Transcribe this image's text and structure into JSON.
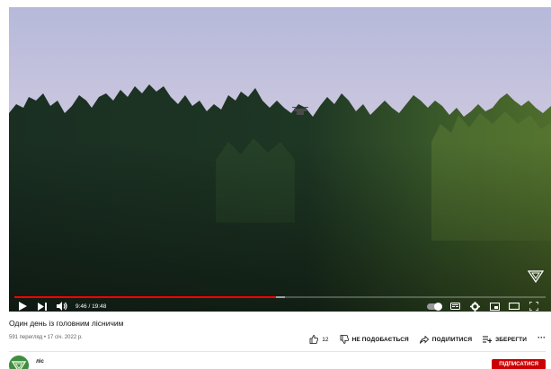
{
  "player": {
    "time_display": "9:46 / 19:48",
    "progress_played": 0.493,
    "progress_buffered": 0.51,
    "colors": {
      "progress": "#ff0000",
      "sky_top": "#b9bcd9",
      "sky_bottom": "#e6d9d4",
      "forest": "#1e3524"
    },
    "icons": [
      "play-icon",
      "next-icon",
      "volume-icon",
      "autoplay-toggle",
      "subtitles-icon",
      "settings-icon",
      "miniplayer-icon",
      "theater-icon",
      "fullscreen-icon"
    ]
  },
  "video": {
    "title": "Один день із головним лісничим",
    "meta": "591 перегляд • 17 січ. 2022 р."
  },
  "actions": {
    "like_count": "12",
    "dislike_label": "НЕ ПОДОБАЄТЬСЯ",
    "share_label": "ПОДІЛИТИСЯ",
    "save_label": "ЗБЕРЕГТИ",
    "more_label": "···"
  },
  "channel": {
    "name": "ліс",
    "subscribe_label": "ПІДПИСАТИСЯ",
    "subscribe_color": "#cc0000"
  }
}
